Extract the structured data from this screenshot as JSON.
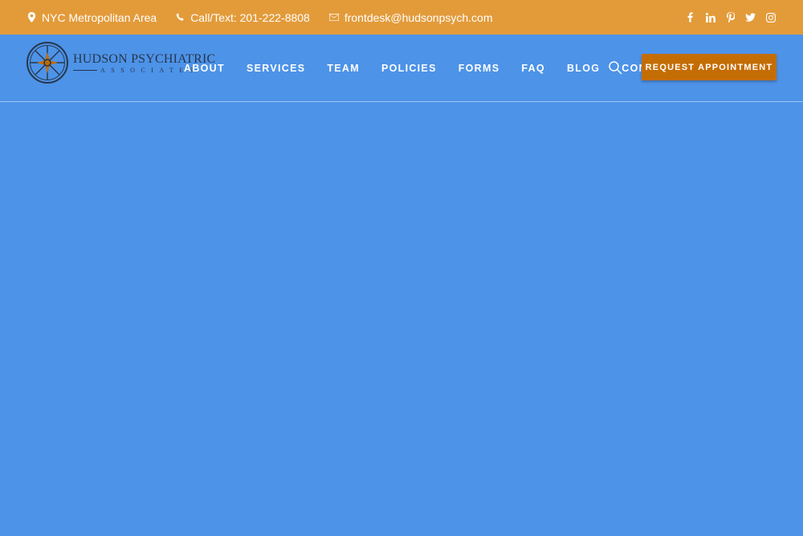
{
  "topbar": {
    "location": "NYC Metropolitan Area",
    "phone": "Call/Text: 201-222-8808",
    "email": "frontdesk@hudsonpsych.com",
    "social": [
      "facebook-icon",
      "linkedin-icon",
      "pinterest-icon",
      "twitter-icon",
      "instagram-icon"
    ]
  },
  "logo": {
    "name": "HUDSON PSYCHIATRIC",
    "sub": "ASSOCIATES"
  },
  "nav": {
    "items": [
      "ABOUT",
      "SERVICES",
      "TEAM",
      "POLICIES",
      "FORMS",
      "FAQ",
      "BLOG",
      "CONTACT"
    ],
    "cta": "REQUEST APPOINTMENT"
  },
  "colors": {
    "topbar": "#e39b3a",
    "background": "#4d93e8",
    "cta": "#c46d05",
    "logo_text": "#27364a"
  }
}
